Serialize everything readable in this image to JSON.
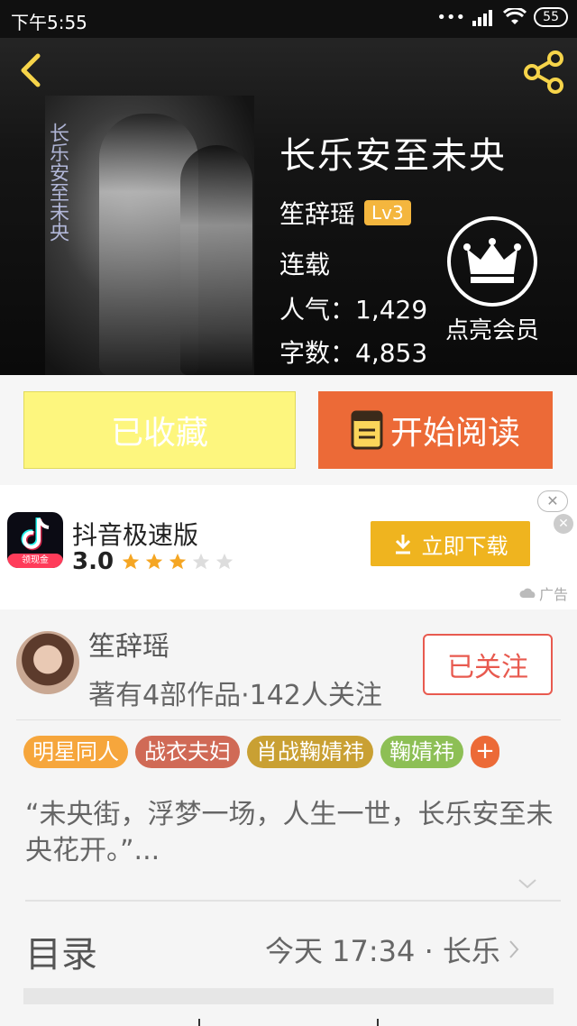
{
  "status_bar": {
    "time": "下午5:55",
    "battery": "55"
  },
  "book": {
    "title": "长乐安至未央",
    "author": "笙辞瑶",
    "level": "Lv3",
    "status": "连载",
    "popularity": "人气：1,429",
    "word_count": "字数：4,853",
    "cover_text": "长乐安至未央"
  },
  "vip": {
    "label": "点亮会员"
  },
  "actions": {
    "favorite_label": "已收藏",
    "read_label": "开始阅读"
  },
  "ad": {
    "app_name": "抖音极速版",
    "rating": "3.0",
    "stars_filled": 3,
    "stars_total": 5,
    "logo_tag": "领现金",
    "download_label": "立即下载",
    "ad_label": "广告"
  },
  "author_card": {
    "name": "笙辞瑶",
    "stats": "著有4部作品·142人关注",
    "follow_label": "已关注"
  },
  "tags": [
    {
      "label": "明星同人",
      "color": "#f6a63c"
    },
    {
      "label": "战衣夫妇",
      "color": "#d06a56"
    },
    {
      "label": "肖战鞠婧祎",
      "color": "#c9a033"
    },
    {
      "label": "鞠婧祎",
      "color": "#8dbf55"
    }
  ],
  "tag_more": "+",
  "intro": "“未央街，浮梦一场，人生一世，长乐安至未央花开。”...",
  "toc": {
    "title": "目录",
    "latest": "今天 17:34 · 长乐"
  },
  "colors": {
    "accent": "#ec6a37",
    "favorite_bg": "#fdf67e",
    "download_bg": "#efb41f",
    "level_badge": "#f4b63e"
  }
}
